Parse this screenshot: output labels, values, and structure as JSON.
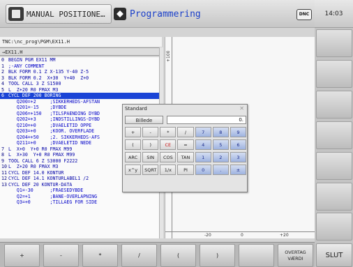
{
  "header": {
    "mode_machine": "MANUAL POSITIONE…",
    "mode_program": "Programmering",
    "dnc_label": "DNC",
    "clock": "14:03"
  },
  "editor": {
    "path": "TNC:\\nc_prog\\PGM\\EX11.H",
    "file": "→EX11.H",
    "lines": [
      {
        "n": "0",
        "code": "BEGIN PGM EX11 MM"
      },
      {
        "n": "1",
        "code": ";-ANY COMMENT"
      },
      {
        "n": "2",
        "code": "BLK FORM 0.1 Z X-135 Y-40 Z-5"
      },
      {
        "n": "3",
        "code": "BLK FORM 0.2  X+30  Y+40  Z+0"
      },
      {
        "n": "4",
        "code": "TOOL CALL 3 Z S1500"
      },
      {
        "n": "5",
        "code": "L  Z+20 R0 FMAX M3"
      },
      {
        "n": "6",
        "code": "CYCL DEF 200 BORING"
      },
      {
        "n": "",
        "code": "   Q200=+2     ;SIKKERHEDS-AFSTAN"
      },
      {
        "n": "",
        "code": "   Q201=-15    ;DYBDE"
      },
      {
        "n": "",
        "code": "   Q206=+150   ;TILSPAENDING DYBD"
      },
      {
        "n": "",
        "code": "   Q202=+3     ;INDSTILLINGS-DYBD"
      },
      {
        "n": "",
        "code": "   Q210=+0     ;DVAELETID OPPE"
      },
      {
        "n": "",
        "code": "   Q203=+0     ;KOOR. OVERFLADE"
      },
      {
        "n": "",
        "code": "   Q204=+50    ;2. SIKKERHEDS-AFS"
      },
      {
        "n": "",
        "code": "   Q211=+0     ;DVAELETID NEDE"
      },
      {
        "n": "7",
        "code": "L  X+0  Y+0 R0 FMAX M99"
      },
      {
        "n": "8",
        "code": "L  X+30  Y+0 R0 FMAX M99"
      },
      {
        "n": "9",
        "code": "TOOL CALL 6 Z S3000 F2222"
      },
      {
        "n": "10",
        "code": "L  Z+20 R0 FMAX M3"
      },
      {
        "n": "11",
        "code": "CYCL DEF 14.0 KONTUR"
      },
      {
        "n": "12",
        "code": "CYCL DEF 14.1 KONTURLABEL1 /2"
      },
      {
        "n": "13",
        "code": "CYCL DEF 20 KONTUR-DATA"
      },
      {
        "n": "",
        "code": "   Q1=-30      ;FRAESEDYBDE"
      },
      {
        "n": "",
        "code": "   Q2=+1       ;BANE-OVERLAPNING"
      },
      {
        "n": "",
        "code": "   Q3=+0       ;TILLAEG FOR SIDE"
      }
    ],
    "selected_line": 6
  },
  "graphics": {
    "ruler_left_label": "+100",
    "ruler_bottom": [
      "-20",
      "0",
      "+20"
    ],
    "marker_icon": "reference-point-icon"
  },
  "calculator": {
    "title": "Standard",
    "close_label": "✕",
    "billede_label": "Billede",
    "display_value": "0.",
    "keys": [
      [
        "+",
        "-",
        "*",
        "/",
        "7",
        "8",
        "9"
      ],
      [
        "(",
        ")",
        "CE",
        "=",
        "4",
        "5",
        "6"
      ],
      [
        "ARC",
        "SIN",
        "COS",
        "TAN",
        "1",
        "2",
        "3"
      ],
      [
        "x^y",
        "SQRT",
        "1/x",
        "PI",
        "0",
        ".",
        "±"
      ]
    ]
  },
  "softkeys": {
    "bottom": [
      "+",
      "-",
      "*",
      "/",
      "(",
      ")",
      "",
      "OVERTAG\nVÆRDI"
    ],
    "slut": "SLUT"
  }
}
